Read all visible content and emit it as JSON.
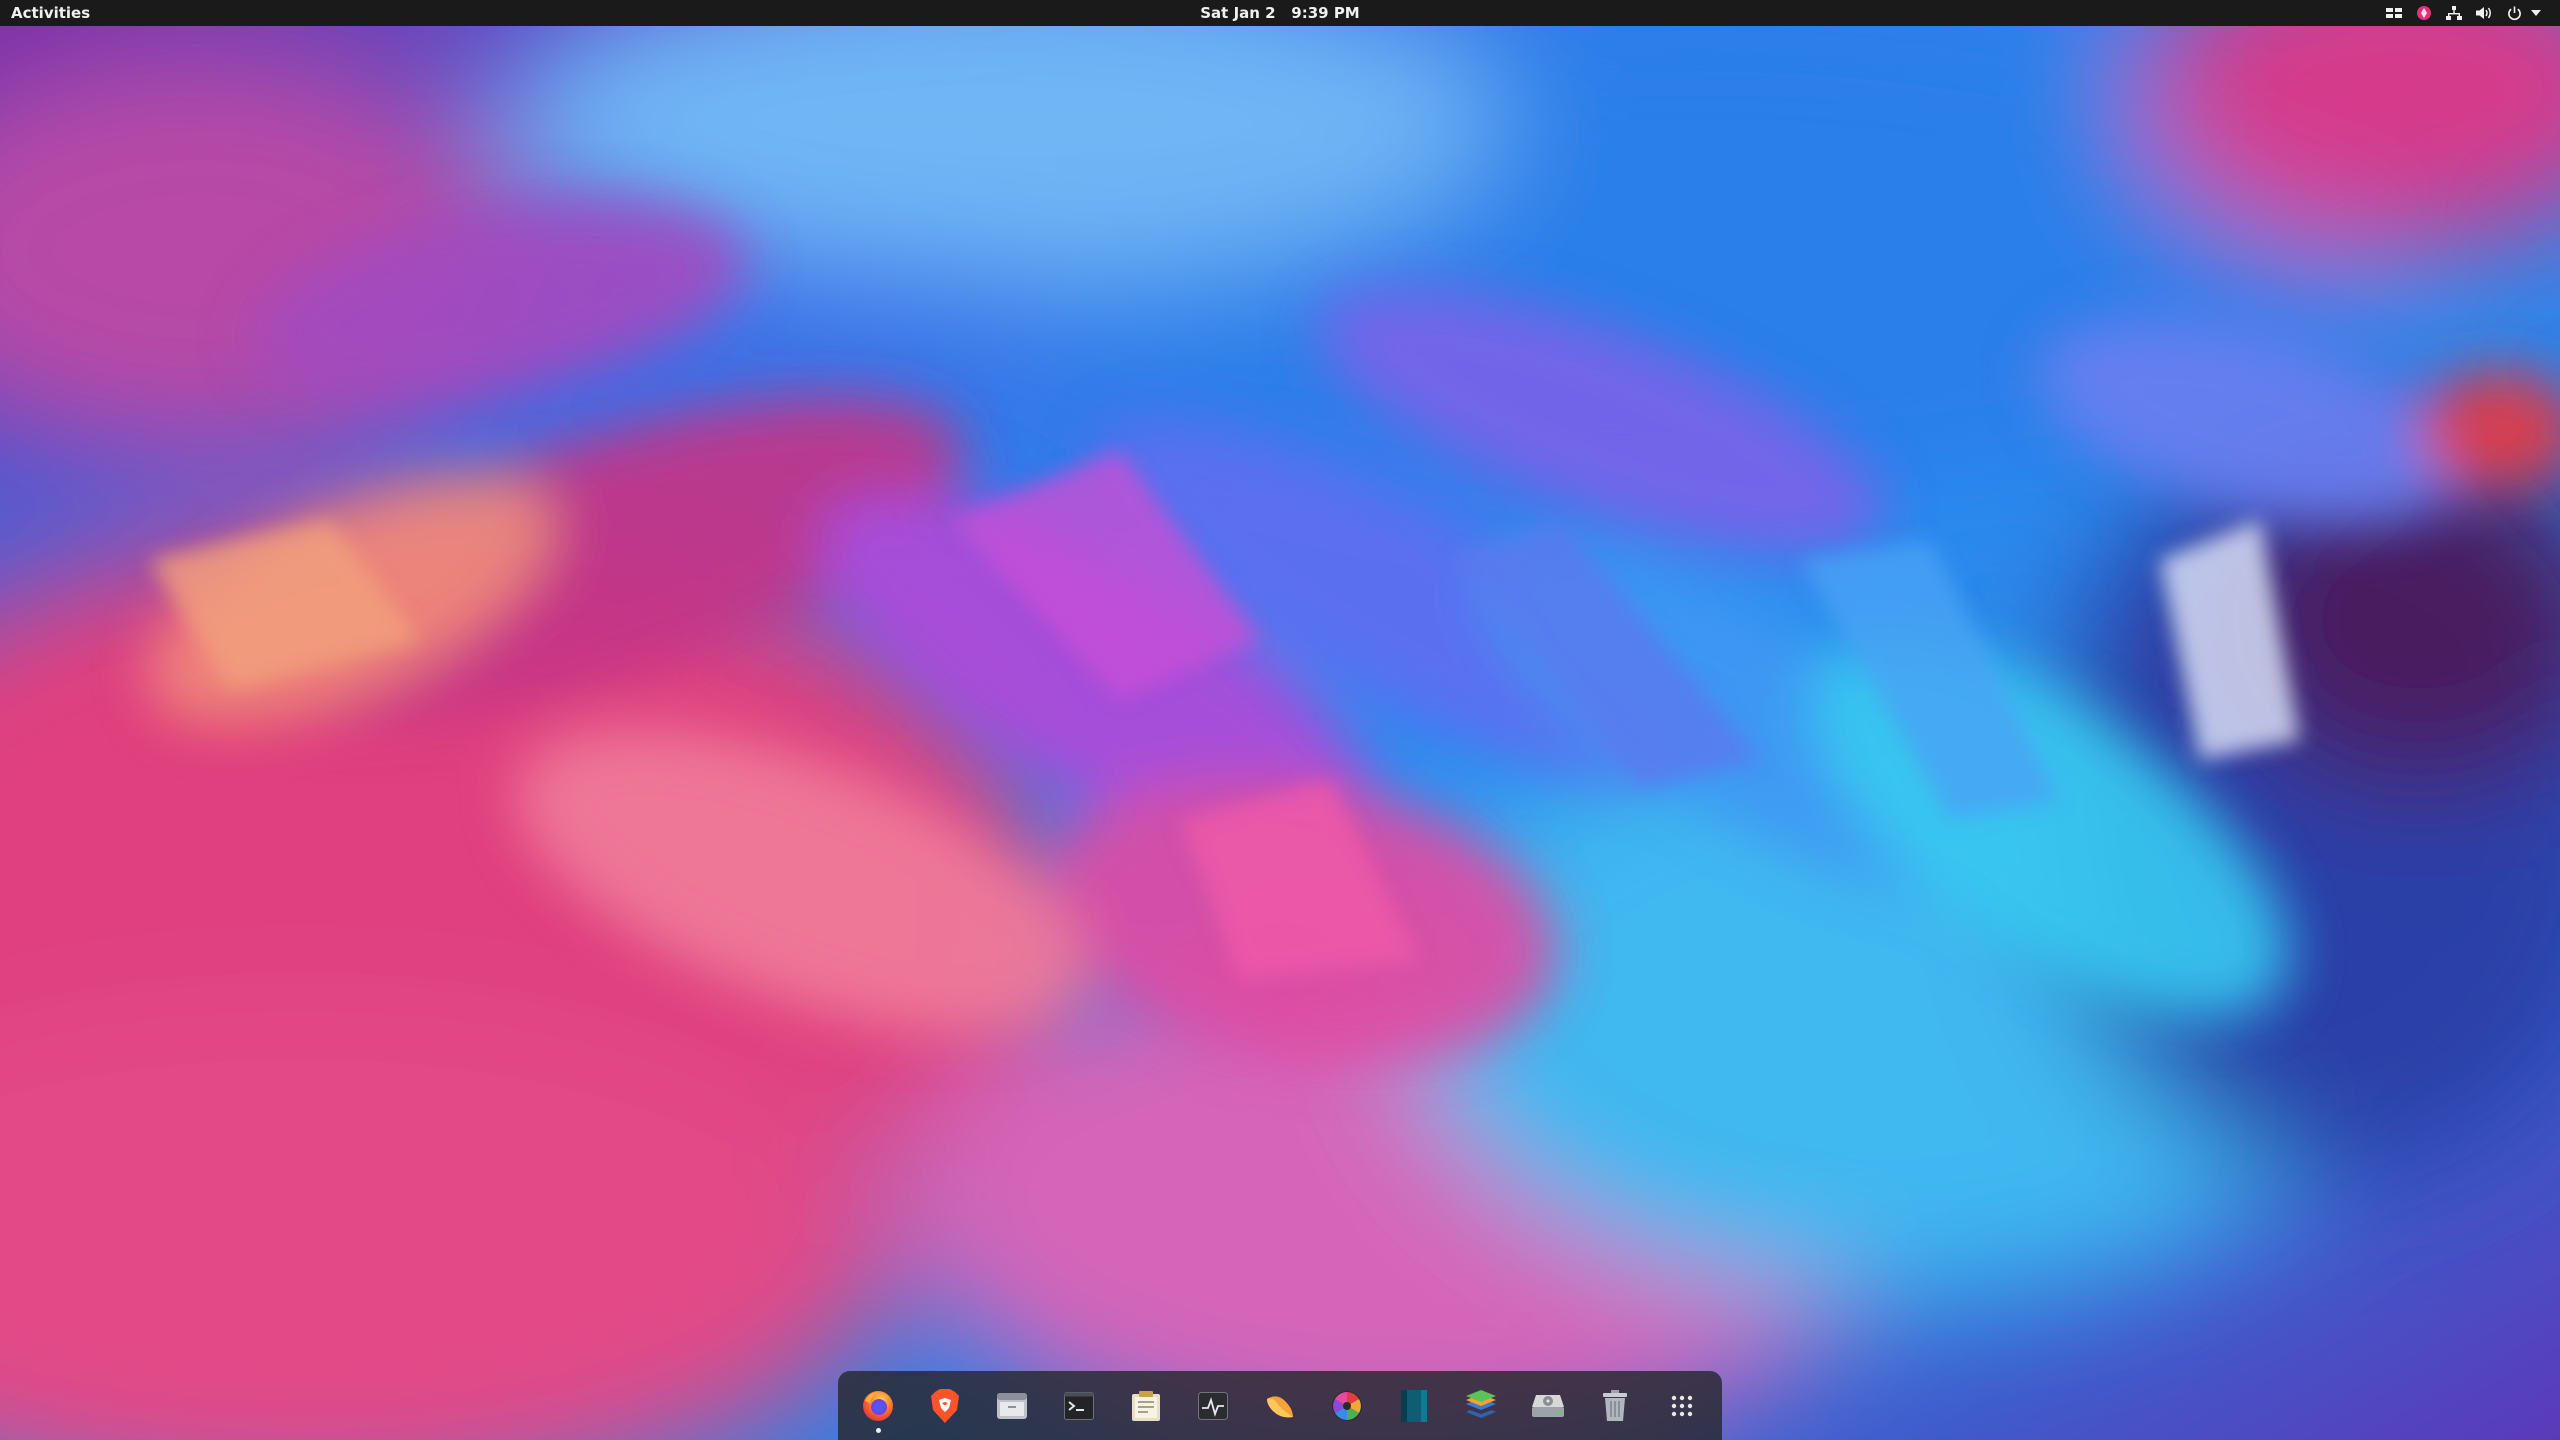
{
  "topbar": {
    "activities_label": "Activities",
    "clock": "Sat Jan 2   9:39 PM",
    "tray_icons": [
      "workspace-switcher-icon",
      "app-indicator-icon",
      "network-icon",
      "volume-icon",
      "power-icon",
      "chevron-down-icon"
    ]
  },
  "dock": {
    "items": [
      {
        "icon": "firefox-icon",
        "running": true
      },
      {
        "icon": "brave-browser-icon",
        "running": false
      },
      {
        "icon": "file-manager-icon",
        "running": false
      },
      {
        "icon": "terminal-icon",
        "running": false
      },
      {
        "icon": "text-editor-icon",
        "running": false
      },
      {
        "icon": "system-monitor-icon",
        "running": false
      },
      {
        "icon": "slack-like-app-icon",
        "running": false
      },
      {
        "icon": "color-picker-icon",
        "running": false
      },
      {
        "icon": "book-reader-icon",
        "running": false
      },
      {
        "icon": "layers-app-icon",
        "running": false
      },
      {
        "icon": "disk-utility-icon",
        "running": false
      },
      {
        "icon": "trash-icon",
        "running": false
      },
      {
        "icon": "show-applications-icon",
        "running": false
      }
    ]
  },
  "colors": {
    "topbar_bg": "#1a1a1a",
    "dock_bg": "#262830",
    "wallpaper_pink": "#e2357b",
    "wallpaper_blue": "#2e8df0",
    "wallpaper_purple": "#9b3fd4",
    "wallpaper_cyan": "#42d6f2"
  }
}
